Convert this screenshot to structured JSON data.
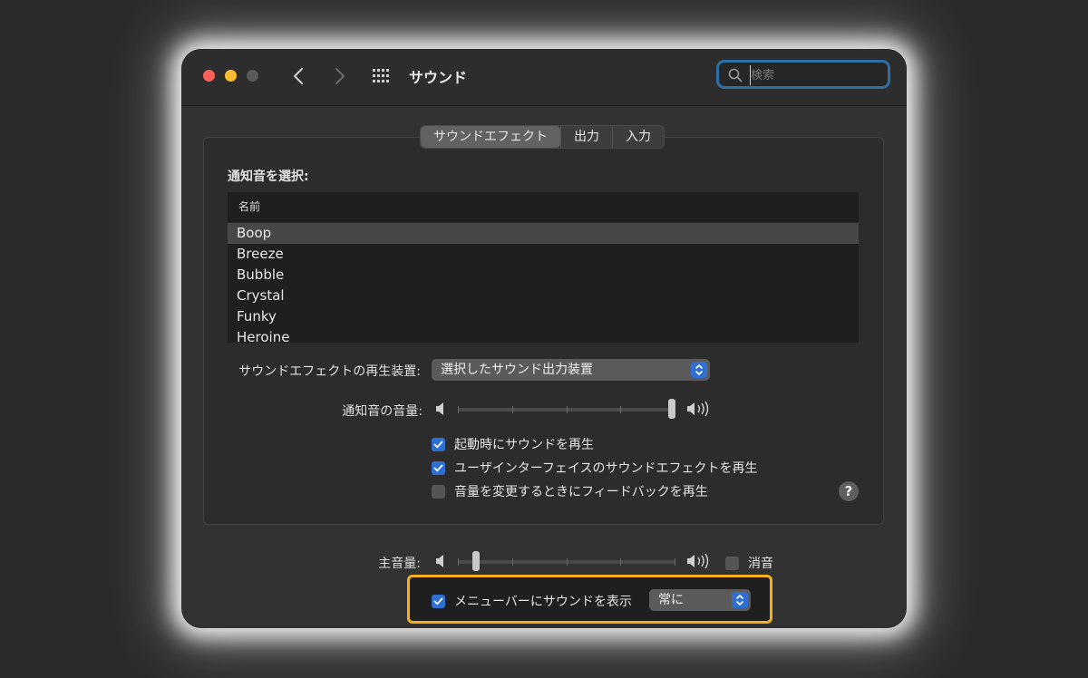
{
  "window": {
    "title": "サウンド",
    "search_placeholder": "検索"
  },
  "tabs": [
    {
      "label": "サウンドエフェクト",
      "active": true
    },
    {
      "label": "出力",
      "active": false
    },
    {
      "label": "入力",
      "active": false
    }
  ],
  "sound_effects": {
    "select_label": "通知音を選択:",
    "list_header": "名前",
    "sounds": [
      "Boop",
      "Breeze",
      "Bubble",
      "Crystal",
      "Funky",
      "Heroine"
    ],
    "selected": "Boop",
    "device_label": "サウンドエフェクトの再生装置:",
    "device_value": "選択したサウンド出力装置",
    "alert_volume_label": "通知音の音量:",
    "alert_volume": 1.0,
    "checkboxes": [
      {
        "label": "起動時にサウンドを再生",
        "checked": true
      },
      {
        "label": "ユーザインターフェイスのサウンドエフェクトを再生",
        "checked": true
      },
      {
        "label": "音量を変更するときにフィードバックを再生",
        "checked": false
      }
    ],
    "help": "?"
  },
  "output": {
    "main_volume_label": "主音量:",
    "main_volume": 0.07,
    "mute_label": "消音",
    "mute_checked": false,
    "menubar_label": "メニューバーにサウンドを表示",
    "menubar_checked": true,
    "menubar_option": "常に"
  },
  "colors": {
    "accent": "#2f6fd2",
    "highlight": "#f5b01d",
    "close": "#ff5f57",
    "minimize": "#febc2e"
  }
}
